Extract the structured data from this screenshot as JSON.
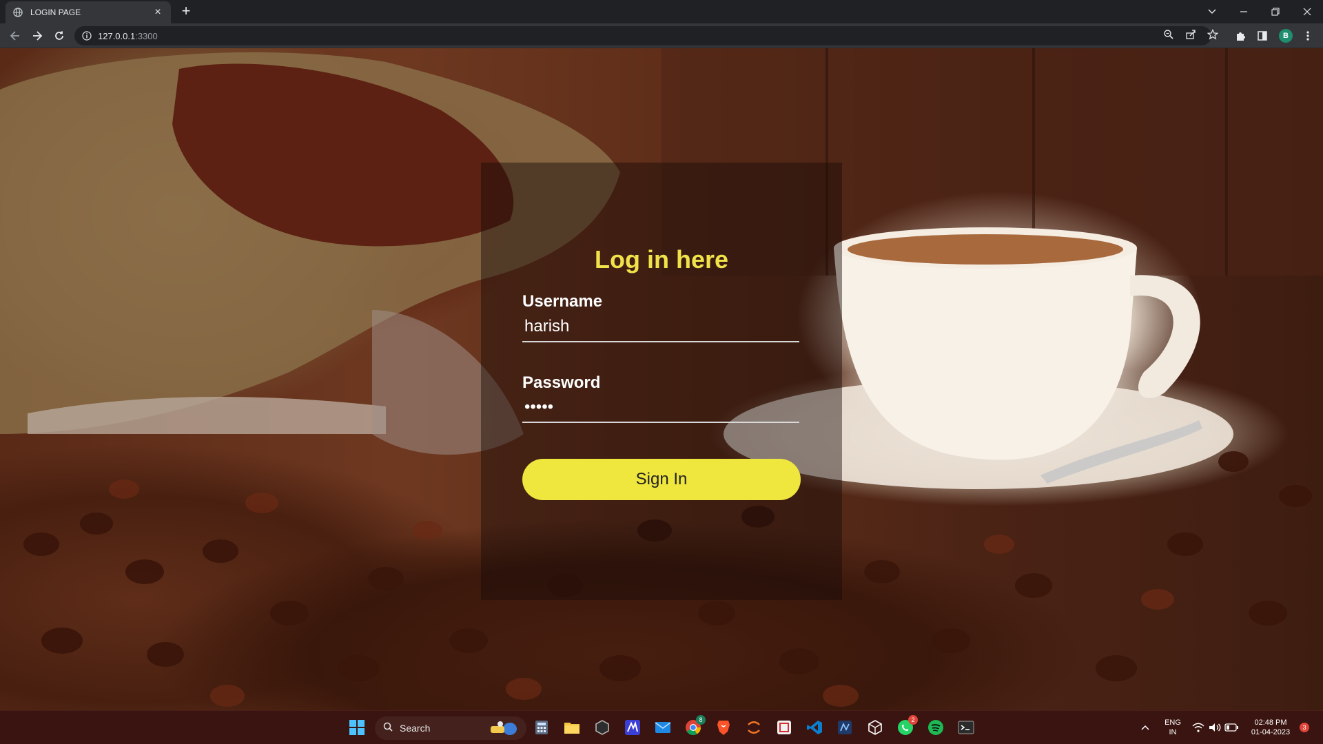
{
  "browser": {
    "tab_title": "LOGIN PAGE",
    "url_host": "127.0.0.1",
    "url_port": ":3300",
    "profile_initial": "B"
  },
  "login": {
    "heading": "Log in here",
    "username_label": "Username",
    "username_value": "harish",
    "password_label": "Password",
    "password_value": "•••••",
    "submit_label": "Sign In"
  },
  "taskbar": {
    "search_label": "Search",
    "language_line1": "ENG",
    "language_line2": "IN",
    "time": "02:48 PM",
    "date": "01-04-2023",
    "notification_count": "3",
    "chrome_badge": "8",
    "whatsapp_badge": "2"
  },
  "colors": {
    "heading": "#f0e24a",
    "button": "#efe63e",
    "taskbar": "#3a1410"
  }
}
